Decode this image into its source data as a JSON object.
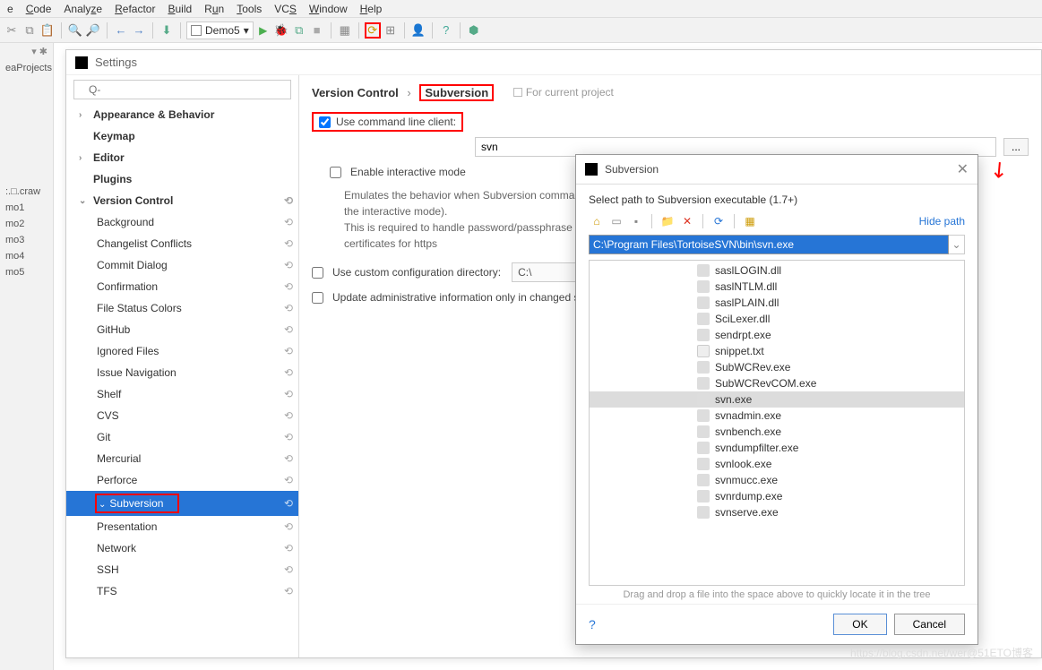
{
  "menubar": [
    "e",
    "Code",
    "Analyze",
    "Refactor",
    "Build",
    "Run",
    "Tools",
    "VCS",
    "Window",
    "Help"
  ],
  "menubar_underline": [
    "",
    "C",
    "A",
    "R",
    "B",
    "R",
    "T",
    "",
    "W",
    "H"
  ],
  "toolbar_project": "Demo5",
  "left_sidebar": {
    "path": "eaProjects",
    "crawl": ":.□.craw",
    "items": [
      "mo1",
      "mo2",
      "mo3",
      "mo4",
      "mo5"
    ]
  },
  "settings": {
    "title": "Settings",
    "search_placeholder": "Q-",
    "breadcrumb": {
      "a": "Version Control",
      "sep": "›",
      "b": "Subversion",
      "proj": "For current project"
    },
    "tree": {
      "appearance": "Appearance & Behavior",
      "keymap": "Keymap",
      "editor": "Editor",
      "plugins": "Plugins",
      "vc": "Version Control",
      "vc_children": [
        "Background",
        "Changelist Conflicts",
        "Commit Dialog",
        "Confirmation",
        "File Status Colors",
        "GitHub",
        "Ignored Files",
        "Issue Navigation",
        "Shelf",
        "CVS",
        "Git",
        "Mercurial",
        "Perforce",
        "Subversion",
        "Presentation",
        "Network",
        "SSH",
        "TFS"
      ]
    },
    "content": {
      "use_cmd": "Use command line client:",
      "cmd_value": "svn",
      "browse": "...",
      "enable_interactive": "Enable interactive mode",
      "desc": "Emulates the behavior when Subversion commands are executed directly from the terminal (in the interactive mode).\nThis is required to handle password/passphrase prompts, and to accept/trust invalid server certificates for https",
      "use_custom": "Use custom configuration directory:",
      "custom_value": "C:\\",
      "custom_browse": "...",
      "update_admin": "Update administrative information only in changed subtrees"
    }
  },
  "dialog": {
    "title": "Subversion",
    "sub": "Select path to Subversion executable (1.7+)",
    "hide": "Hide path",
    "path": "C:\\Program Files\\TortoiseSVN\\bin\\svn.exe",
    "files": [
      {
        "n": "saslLOGIN.dll",
        "t": "lib"
      },
      {
        "n": "saslNTLM.dll",
        "t": "lib"
      },
      {
        "n": "saslPLAIN.dll",
        "t": "lib"
      },
      {
        "n": "SciLexer.dll",
        "t": "lib"
      },
      {
        "n": "sendrpt.exe",
        "t": "exe"
      },
      {
        "n": "snippet.txt",
        "t": "txt"
      },
      {
        "n": "SubWCRev.exe",
        "t": "exe"
      },
      {
        "n": "SubWCRevCOM.exe",
        "t": "exe"
      },
      {
        "n": "svn.exe",
        "t": "exe",
        "sel": true
      },
      {
        "n": "svnadmin.exe",
        "t": "exe"
      },
      {
        "n": "svnbench.exe",
        "t": "exe"
      },
      {
        "n": "svndumpfilter.exe",
        "t": "exe"
      },
      {
        "n": "svnlook.exe",
        "t": "exe"
      },
      {
        "n": "svnmucc.exe",
        "t": "exe"
      },
      {
        "n": "svnrdump.exe",
        "t": "exe"
      },
      {
        "n": "svnserve.exe",
        "t": "exe"
      }
    ],
    "drag": "Drag and drop a file into the space above to quickly locate it in the tree",
    "ok": "OK",
    "cancel": "Cancel"
  },
  "watermark": "https://blog.csdn.net/wer@51ETO博客"
}
